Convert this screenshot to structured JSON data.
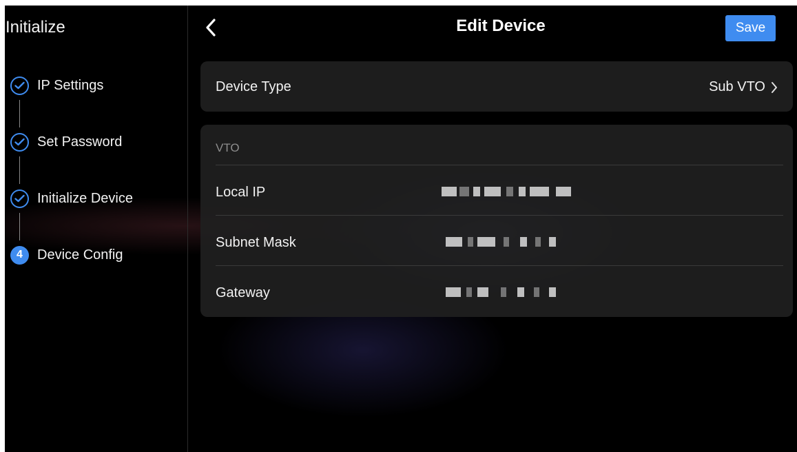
{
  "sidebar": {
    "title": "Initialize",
    "steps": [
      {
        "label": "IP Settings",
        "status": "done"
      },
      {
        "label": "Set Password",
        "status": "done"
      },
      {
        "label": "Initialize Device",
        "status": "done"
      },
      {
        "label": "Device Config",
        "status": "current",
        "number": "4"
      }
    ]
  },
  "header": {
    "back_icon": "chevron-left-icon",
    "title": "Edit Device",
    "save_label": "Save"
  },
  "device_type": {
    "label": "Device Type",
    "value": "Sub VTO",
    "chevron_icon": "chevron-right-icon"
  },
  "network": {
    "section_title": "VTO",
    "rows": [
      {
        "label": "Local IP"
      },
      {
        "label": "Subnet Mask"
      },
      {
        "label": "Gateway"
      }
    ]
  },
  "colors": {
    "accent": "#3f8cf0",
    "background": "#000000",
    "card": "#202020"
  }
}
